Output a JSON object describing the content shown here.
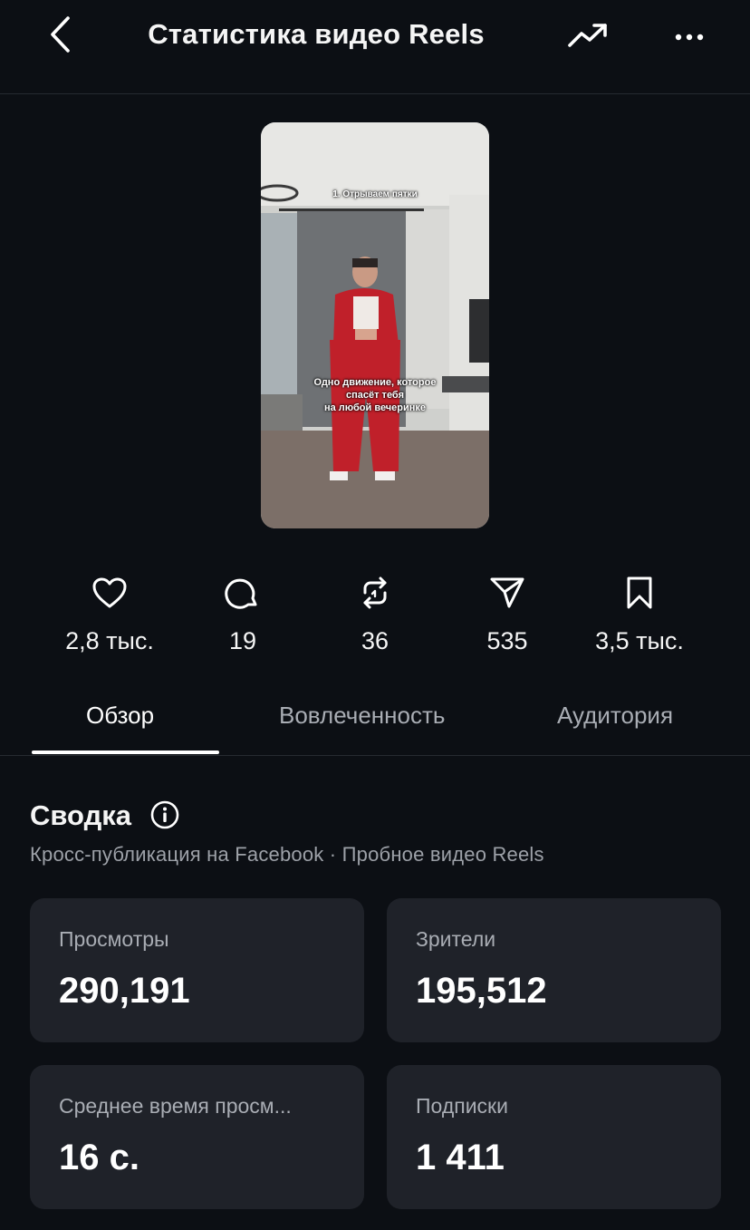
{
  "header": {
    "title": "Статистика видео Reels",
    "icons": {
      "back": "chevron-left-icon",
      "trend": "trending-up-icon",
      "more": "more-horizontal-icon"
    }
  },
  "video": {
    "caption_top": "1. Отрываем пятки",
    "caption_line1": "Одно движение, которое",
    "caption_line2": "спасёт тебя",
    "caption_line3": "на любой вечеринке"
  },
  "stats": [
    {
      "icon": "heart-icon",
      "value": "2,8 тыс."
    },
    {
      "icon": "comment-icon",
      "value": "19"
    },
    {
      "icon": "repost-icon",
      "value": "36"
    },
    {
      "icon": "send-icon",
      "value": "535"
    },
    {
      "icon": "bookmark-icon",
      "value": "3,5 тыс."
    }
  ],
  "tabs": [
    {
      "label": "Обзор",
      "active": true
    },
    {
      "label": "Вовлеченность",
      "active": false
    },
    {
      "label": "Аудитория",
      "active": false
    }
  ],
  "summary": {
    "title": "Сводка",
    "subtitle": "Кросс-публикация на Facebook · Пробное видео Reels",
    "cards": [
      {
        "label": "Просмотры",
        "value": "290,191"
      },
      {
        "label": "Зрители",
        "value": "195,512"
      },
      {
        "label": "Среднее время просм...",
        "value": "16 с."
      },
      {
        "label": "Подписки",
        "value": "1 411"
      }
    ]
  },
  "colors": {
    "background": "#0c0f14",
    "card": "#1f2229",
    "text": "#f5f5f5",
    "muted": "#a9adb4"
  }
}
